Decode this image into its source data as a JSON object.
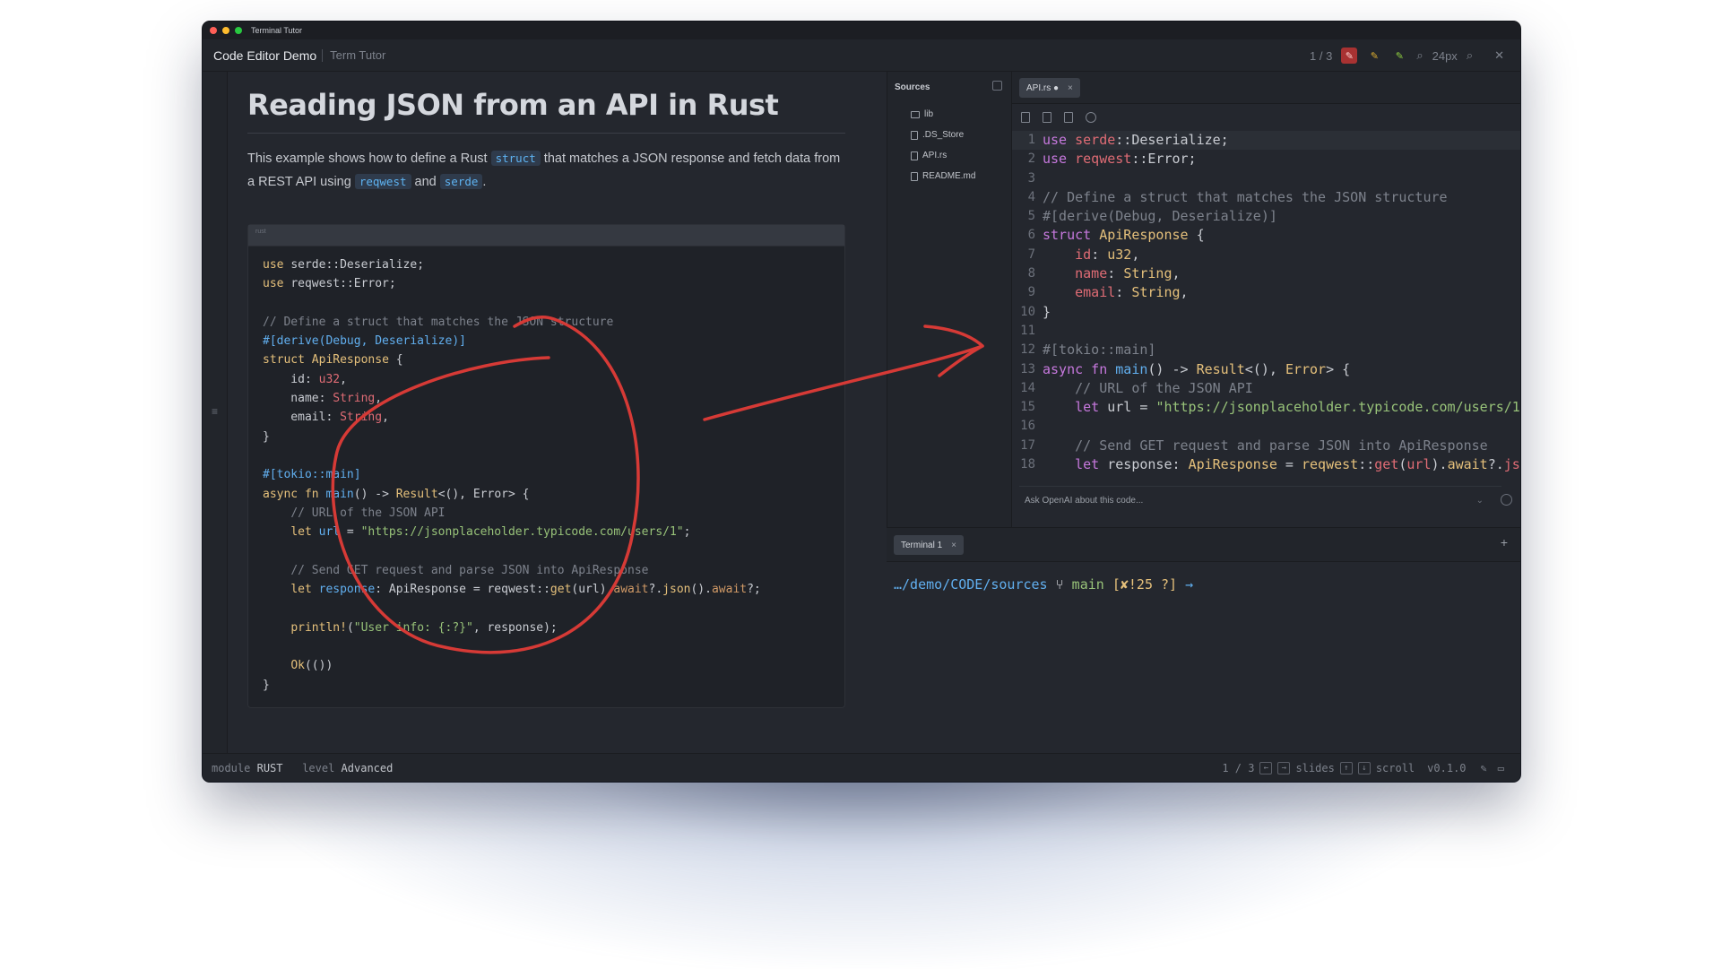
{
  "window": {
    "title": "Terminal Tutor",
    "traffic_colors": [
      "#ff5f57",
      "#febc2e",
      "#28c840"
    ]
  },
  "appbar": {
    "title": "Code Editor Demo",
    "subtitle": "Term Tutor",
    "page_indicator": "1 / 3",
    "zoom": "24px",
    "pen_colors": [
      "#e05252",
      "#e0b030",
      "#90d040"
    ]
  },
  "slide": {
    "heading": "Reading JSON from an API in Rust",
    "para_1": "This example shows how to define a Rust ",
    "tag_struct": "struct",
    "para_2": " that matches a JSON response and fetch data from a REST API using ",
    "tag_reqwest": "reqwest",
    "para_3": " and ",
    "tag_serde": "serde",
    "para_4": ".",
    "code_lang": "rust",
    "code_lines": [
      "use serde::Deserialize;",
      "use reqwest::Error;",
      "",
      "// Define a struct that matches the JSON structure",
      "#[derive(Debug, Deserialize)]",
      "struct ApiResponse {",
      "    id: u32,",
      "    name: String,",
      "    email: String,",
      "}",
      "",
      "#[tokio::main]",
      "async fn main() -> Result<(), Error> {",
      "    // URL of the JSON API",
      "    let url = \"https://jsonplaceholder.typicode.com/users/1\";",
      "",
      "    // Send GET request and parse JSON into ApiResponse",
      "    let response: ApiResponse = reqwest::get(url).await?.json().await?;",
      "",
      "    println!(\"User info: {:?}\", response);",
      "",
      "    Ok(())",
      "}"
    ]
  },
  "sources": {
    "header": "Sources",
    "items": [
      {
        "name": "lib",
        "kind": "folder"
      },
      {
        "name": ".DS_Store",
        "kind": "file"
      },
      {
        "name": "API.rs",
        "kind": "file"
      },
      {
        "name": "README.md",
        "kind": "file"
      }
    ]
  },
  "editor": {
    "tab_label": "API.rs ●",
    "tab_close": "×",
    "line_numbers": [
      "1",
      "2",
      "3",
      "4",
      "5",
      "6",
      "7",
      "8",
      "9",
      "10",
      "11",
      "12",
      "13",
      "14",
      "15",
      "16",
      "17",
      "18"
    ],
    "ask_placeholder": "Ask OpenAI about this code..."
  },
  "terminal": {
    "tab_label": "Terminal 1",
    "tab_close": "×",
    "add": "+",
    "path": "…/demo/CODE/sources",
    "branch_icon": "git-branch-icon",
    "branch": "main",
    "git_status": "[✘!25 ?]",
    "arrow": "→"
  },
  "status": {
    "module_label": "module",
    "module_value": "RUST",
    "level_label": "level",
    "level_value": "Advanced",
    "page": "1 / 3",
    "slides_label": "slides",
    "scroll_label": "scroll",
    "version": "v0.1.0"
  },
  "annotation": {
    "color": "#d63a36"
  }
}
